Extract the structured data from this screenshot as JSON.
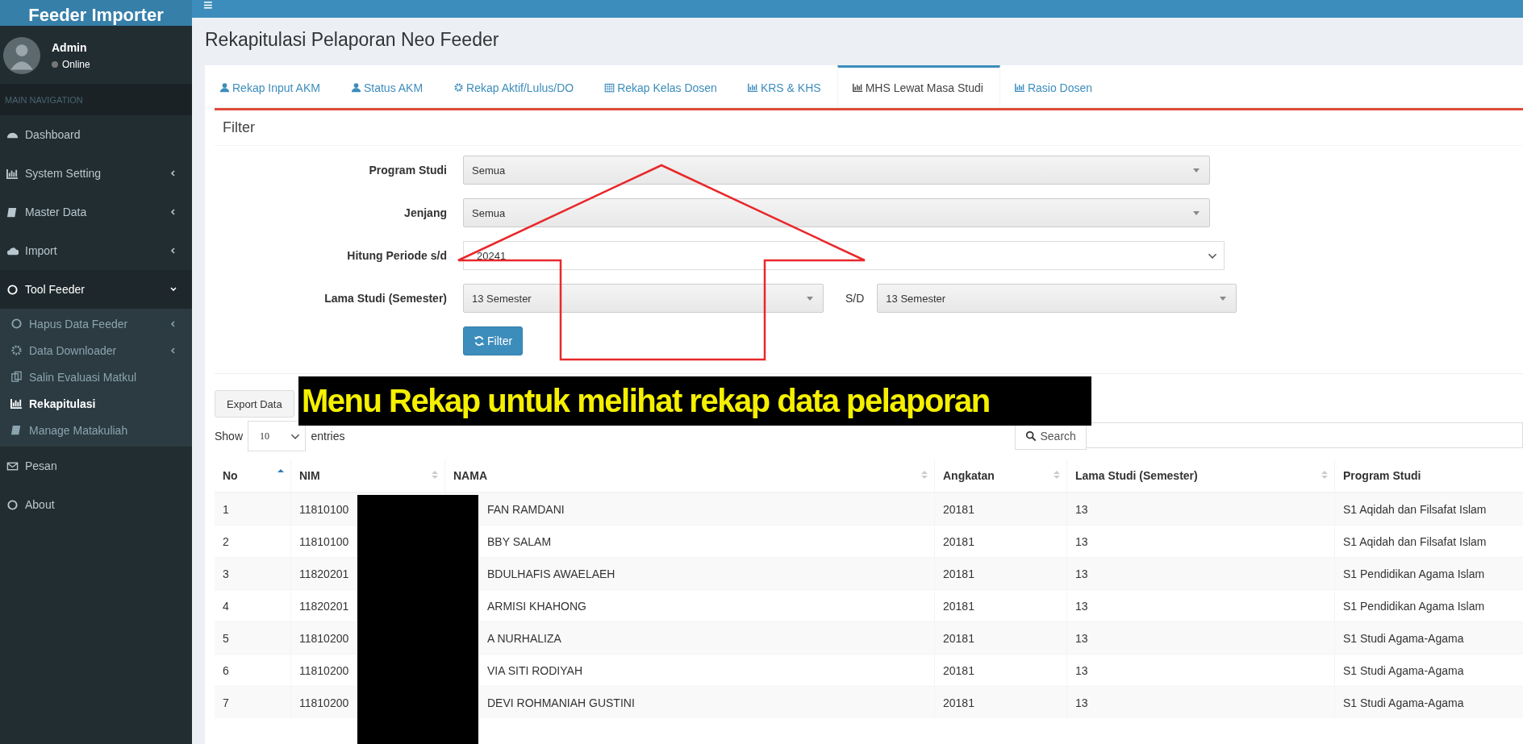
{
  "app": {
    "title": "Feeder Importer",
    "menu_icon": "≡"
  },
  "user": {
    "name": "Admin",
    "status": "Online"
  },
  "sidebar": {
    "header": "MAIN NAVIGATION",
    "items": [
      {
        "label": "Dashboard"
      },
      {
        "label": "System Setting",
        "expanded": false
      },
      {
        "label": "Master Data",
        "expanded": false
      },
      {
        "label": "Import",
        "expanded": false
      },
      {
        "label": "Tool Feeder",
        "expanded": true,
        "children": [
          {
            "label": "Hapus Data Feeder",
            "expanded": false,
            "selected": false
          },
          {
            "label": "Data Downloader",
            "expanded": false,
            "selected": false
          },
          {
            "label": "Salin Evaluasi Matkul",
            "selected": false
          },
          {
            "label": "Rekapitulasi",
            "selected": true
          },
          {
            "label": "Manage Matakuliah",
            "selected": false
          }
        ]
      },
      {
        "label": "Pesan"
      },
      {
        "label": "About"
      }
    ]
  },
  "page_title": "Rekapitulasi Pelaporan Neo Feeder",
  "tabs": [
    {
      "label": "Rekap Input AKM",
      "selected": false
    },
    {
      "label": "Status AKM",
      "selected": false
    },
    {
      "label": "Rekap Aktif/Lulus/DO",
      "selected": false
    },
    {
      "label": "Rekap Kelas Dosen",
      "selected": false
    },
    {
      "label": "KRS & KHS",
      "selected": false
    },
    {
      "label": "MHS Lewat Masa Studi",
      "selected": true
    },
    {
      "label": "Rasio Dosen",
      "selected": false
    }
  ],
  "filter": {
    "title": "Filter",
    "fields": [
      {
        "kind": "select",
        "label": "Program Studi",
        "value": "Semua"
      },
      {
        "kind": "select",
        "label": "Jenjang",
        "value": "Semua"
      },
      {
        "kind": "dropdown",
        "label": "Hitung Periode s/d",
        "value": "20241"
      },
      {
        "kind": "range",
        "label": "Lama Studi (Semester)",
        "value": "13 Semester",
        "separator": "S/D",
        "value_to": "13 Semester"
      }
    ],
    "button": "Filter"
  },
  "export_button": "Export Data",
  "length": {
    "before": "Show",
    "value": "10",
    "after": "entries"
  },
  "search": {
    "label": "Search"
  },
  "table": {
    "columns": [
      {
        "label": "No",
        "sorted": true
      },
      {
        "label": "NIM",
        "sorted": false
      },
      {
        "label": "NAMA",
        "sorted": false
      },
      {
        "label": "Angkatan",
        "sorted": false
      },
      {
        "label": "Lama Studi (Semester)",
        "sorted": false
      },
      {
        "label": "Program Studi"
      }
    ],
    "rows": [
      {
        "no": "1",
        "nim": "11810100",
        "nama": "FAN RAMDANI",
        "angkatan": "20181",
        "lama": "13",
        "prodi": "S1 Aqidah dan Filsafat Islam"
      },
      {
        "no": "2",
        "nim": "11810100",
        "nama": "BBY SALAM",
        "angkatan": "20181",
        "lama": "13",
        "prodi": "S1 Aqidah dan Filsafat Islam"
      },
      {
        "no": "3",
        "nim": "11820201",
        "nama": "BDULHAFIS AWAELAEH",
        "angkatan": "20181",
        "lama": "13",
        "prodi": "S1 Pendidikan Agama Islam"
      },
      {
        "no": "4",
        "nim": "11820201",
        "nama": "ARMISI KHAHONG",
        "angkatan": "20181",
        "lama": "13",
        "prodi": "S1 Pendidikan Agama Islam"
      },
      {
        "no": "5",
        "nim": "11810200",
        "nama": "A NURHALIZA",
        "angkatan": "20181",
        "lama": "13",
        "prodi": "S1 Studi Agama-Agama"
      },
      {
        "no": "6",
        "nim": "11810200",
        "nama": "VIA SITI RODIYAH",
        "angkatan": "20181",
        "lama": "13",
        "prodi": "S1 Studi Agama-Agama"
      },
      {
        "no": "7",
        "nim": "11810200",
        "nama": "DEVI ROHMANIAH GUSTINI",
        "angkatan": "20181",
        "lama": "13",
        "prodi": "S1 Studi Agama-Agama"
      }
    ]
  },
  "annotation": {
    "caption": "Menu Rekap untuk melihat rekap data pelaporan"
  }
}
